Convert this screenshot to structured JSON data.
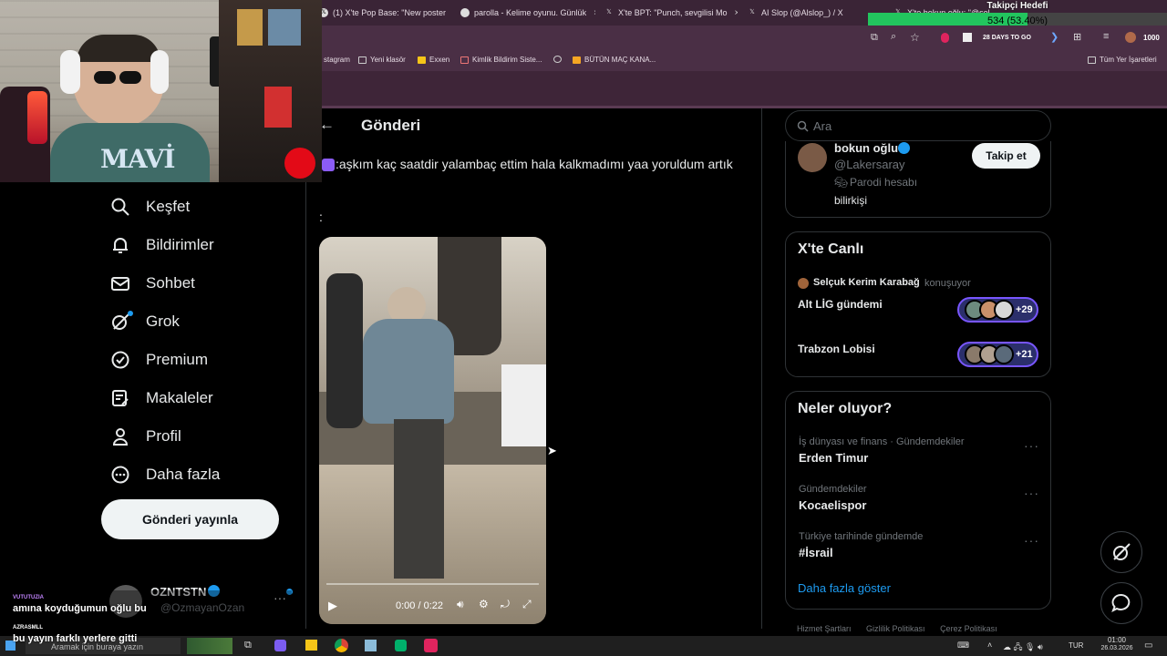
{
  "browser": {
    "tabs": [
      {
        "label": "(1) X'te Pop Base: \"New poster"
      },
      {
        "label": "parolla - Kelime oyunu. Günlük"
      },
      {
        "label": "X'te BPT: \"Punch, sevgilisi Mo"
      },
      {
        "label": "AI Slop (@Alslop_) / X"
      },
      {
        "label": "X'te bokun oğlu: \"@sel"
      }
    ],
    "bookmarks": [
      "stagram",
      "Yeni klasör",
      "Exxen",
      "Kimlik Bildirim Siste...",
      "BÜTÜN MAÇ KANA..."
    ],
    "all_bookmarks": "Tüm Yer İşaretleri",
    "toolbar_counter": "1000",
    "days_badge": "28 DAYS TO GO"
  },
  "follower_goal": {
    "title": "Takipçi Hedefi",
    "progress_text": "534 (53.40%)",
    "progress_fraction": 0.534,
    "color": "#22c55e"
  },
  "nav": {
    "items": [
      {
        "label": "Keşfet",
        "icon": "search-icon"
      },
      {
        "label": "Bildirimler",
        "icon": "bell-icon"
      },
      {
        "label": "Sohbet",
        "icon": "mail-icon"
      },
      {
        "label": "Grok",
        "icon": "grok-icon"
      },
      {
        "label": "Premium",
        "icon": "verified-badge-icon"
      },
      {
        "label": "Makaleler",
        "icon": "article-icon"
      },
      {
        "label": "Profil",
        "icon": "person-icon"
      },
      {
        "label": "Daha fazla",
        "icon": "more-circle-icon"
      }
    ],
    "post_button": "Gönderi yayınla",
    "account_name": "OZNTSTN",
    "account_handle": "@OzmayanOzan"
  },
  "main": {
    "back_icon": "arrow-left-icon",
    "header_title": "Gönderi",
    "post_text": ":aşkım kaç saatdir yalambaç ettim hala kalkmadımı yaa yoruldum artık",
    "post_text_2": ":",
    "video": {
      "time": "0:00 / 0:22",
      "progress_fraction": 0.0
    }
  },
  "right": {
    "search_placeholder": "Ara",
    "profile": {
      "name": "bokun oğlu",
      "handle": "@Lakersaray",
      "parody_label": "Parodi hesabı",
      "bio": "bilirkişi",
      "follow_button": "Takip et"
    },
    "live": {
      "title": "X'te Canlı",
      "speaker": "Selçuk Kerim Karabağ",
      "speaker_suffix": "konuşuyor",
      "spaces": [
        {
          "title": "Alt LİG gündemi",
          "count": "+29"
        },
        {
          "title": "Trabzon Lobisi",
          "count": "+21"
        }
      ]
    },
    "trends": {
      "title": "Neler oluyor?",
      "items": [
        {
          "category": "İş dünyası ve finans · Gündemdekiler",
          "title": "Erden Timur"
        },
        {
          "category": "Gündemdekiler",
          "title": "Kocaelispor"
        },
        {
          "category": "Türkiye tarihinde gündemde",
          "title": "#İsrail"
        }
      ],
      "show_more": "Daha fazla göster"
    },
    "footer_links": [
      "Hizmet Şartları",
      "Gizlilik Politikası",
      "Çerez Politikası"
    ]
  },
  "chat_overlay": [
    {
      "user": "VUTUTUZIA",
      "message": "amına koyduğumun oğlu bu",
      "color": "#c084fc"
    },
    {
      "user": "AZRASMLL",
      "message": "bu yayın farklı yerlere gitti",
      "color": "#ffffff"
    }
  ],
  "taskbar": {
    "search_placeholder": "Aramak için buraya yazın",
    "language": "TUR",
    "time": "01:00",
    "date": "26.03.2026"
  }
}
